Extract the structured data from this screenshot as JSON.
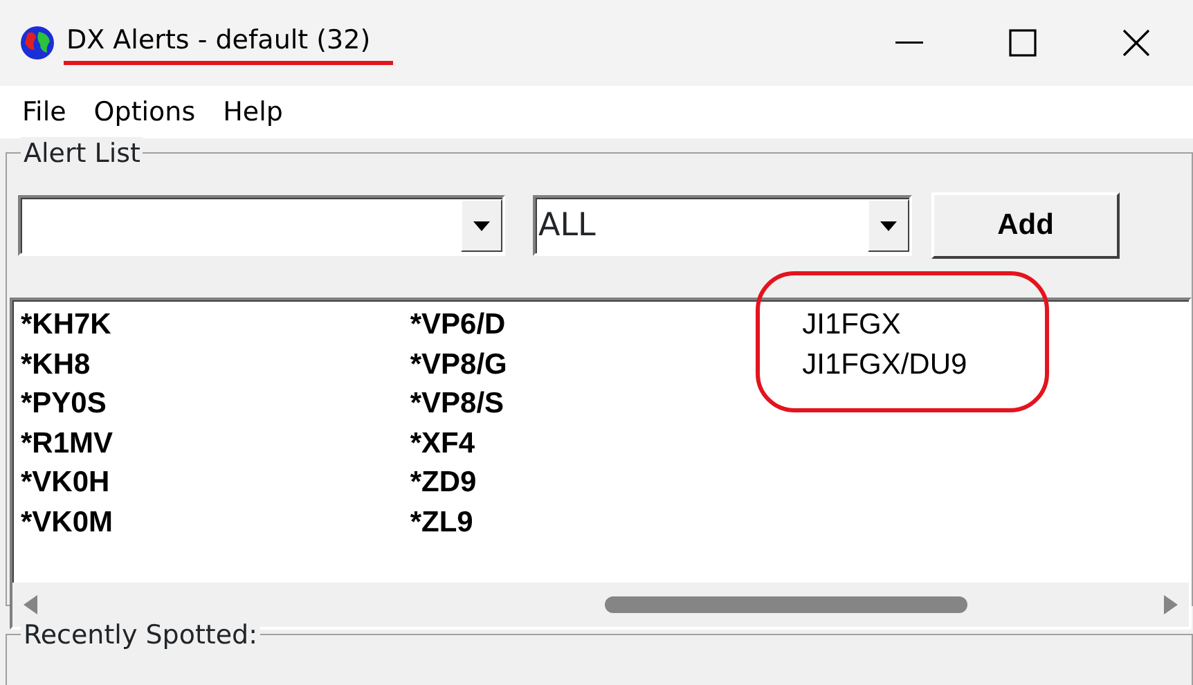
{
  "window": {
    "title": "DX Alerts - default (32)"
  },
  "menu": [
    "File",
    "Options",
    "Help"
  ],
  "alert_list": {
    "label": "Alert List",
    "combo_2": {
      "value": "ALL"
    },
    "add_button": "Add",
    "columns": [
      [
        {
          "text": "*KH7K",
          "bold": true
        },
        {
          "text": "*KH8",
          "bold": true
        },
        {
          "text": "*PY0S",
          "bold": true
        },
        {
          "text": "*R1MV",
          "bold": true
        },
        {
          "text": "*VK0H",
          "bold": true
        },
        {
          "text": "*VK0M",
          "bold": true
        }
      ],
      [
        {
          "text": "*VP6/D",
          "bold": true
        },
        {
          "text": "*VP8/G",
          "bold": true
        },
        {
          "text": "*VP8/S",
          "bold": true
        },
        {
          "text": "*XF4",
          "bold": true
        },
        {
          "text": "*ZD9",
          "bold": true
        },
        {
          "text": "*ZL9",
          "bold": true
        }
      ],
      [
        {
          "text": "JI1FGX",
          "bold": false
        },
        {
          "text": "JI1FGX/DU9",
          "bold": false
        }
      ]
    ]
  },
  "recently_spotted": {
    "label": "Recently Spotted:"
  }
}
